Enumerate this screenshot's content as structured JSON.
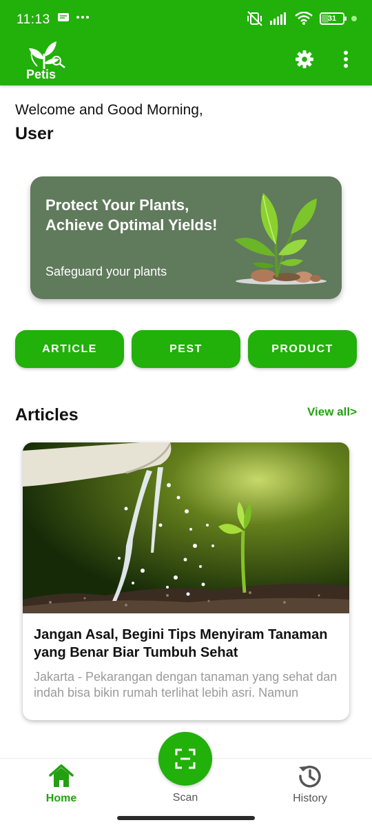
{
  "status_bar": {
    "time": "11:13",
    "battery_level": "31",
    "battery_fraction": 0.31
  },
  "app_bar": {
    "logo_text": "Petis"
  },
  "greeting": {
    "line1": "Welcome and Good Morning,",
    "name": "User"
  },
  "banner": {
    "title": "Protect Your Plants, Achieve Optimal Yields!",
    "subtitle": "Safeguard your plants"
  },
  "categories": [
    {
      "label": "ARTICLE"
    },
    {
      "label": "PEST"
    },
    {
      "label": "PRODUCT"
    }
  ],
  "articles_section": {
    "title": "Articles",
    "view_all": "View all>"
  },
  "articles": [
    {
      "title": "Jangan Asal, Begini Tips Menyiram Tanaman yang Benar Biar Tumbuh Sehat",
      "excerpt": "Jakarta - Pekarangan dengan tanaman yang sehat dan indah bisa bikin rumah terlihat lebih asri. Namun"
    }
  ],
  "bottom_nav": {
    "home": "Home",
    "scan": "Scan",
    "history": "History"
  },
  "colors": {
    "primary": "#22b00a",
    "banner": "#607a5c",
    "active_nav": "#22a010",
    "inactive_nav": "#555555"
  },
  "icons": {
    "status_left": [
      "message-icon",
      "more-dots-icon"
    ],
    "status_right": [
      "vibrate-off-icon",
      "signal-icon",
      "wifi-icon",
      "battery-icon"
    ],
    "app_bar": [
      "settings-gear-icon",
      "overflow-menu-icon"
    ],
    "nav": [
      "home-icon",
      "scan-icon",
      "history-icon"
    ]
  }
}
